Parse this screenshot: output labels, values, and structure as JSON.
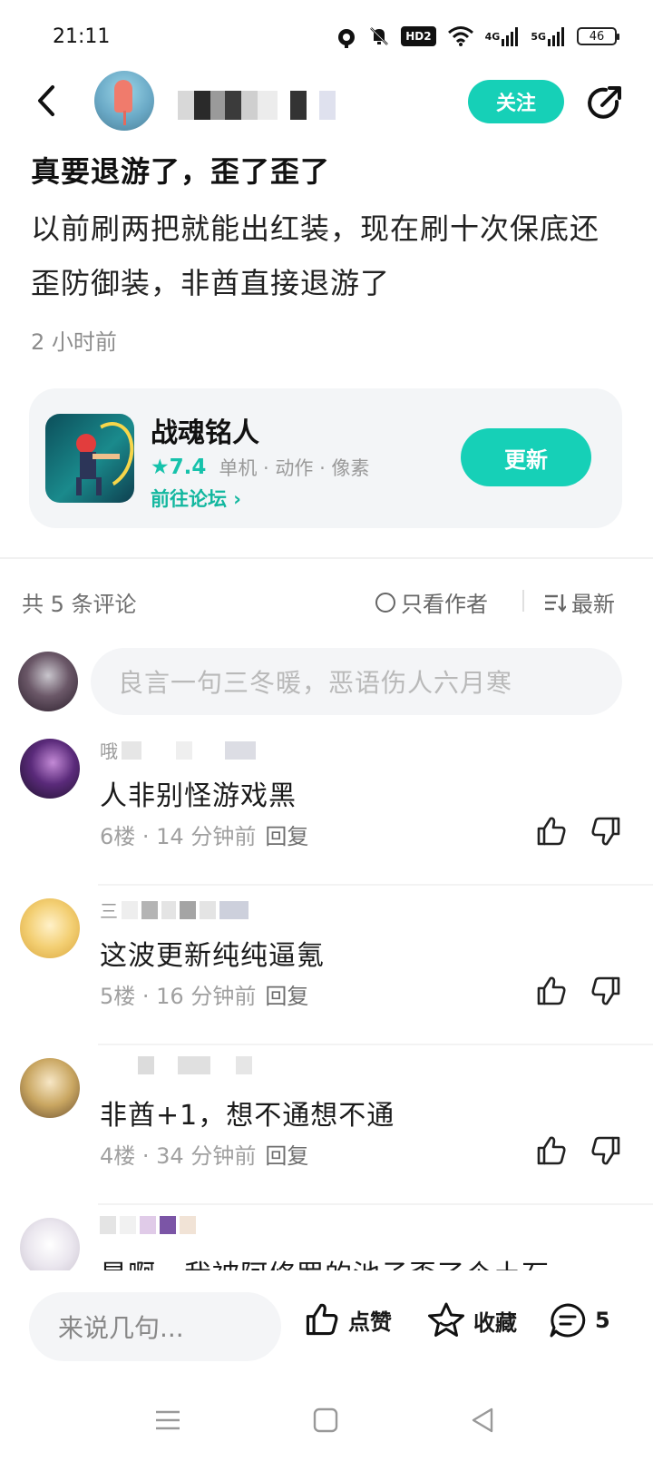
{
  "status_bar": {
    "time": "21:11",
    "icons": [
      "alarm-icon",
      "mute-icon",
      "hd-icon",
      "wifi-icon",
      "signal-4g-icon",
      "signal-5g-icon",
      "battery-icon"
    ],
    "hd_label": "HD2",
    "net_4g": "4G",
    "net_5g": "5G",
    "battery": "46"
  },
  "header": {
    "follow_label": "关注"
  },
  "post": {
    "title": "真要退游了，歪了歪了",
    "body": "以前刷两把就能出红装，现在刷十次保底还歪防御装，非酋直接退游了",
    "time": "2 小时前"
  },
  "game_card": {
    "name": "战魂铭人",
    "rating": "★7.4",
    "tags": "单机 · 动作 · 像素",
    "forum_link": "前往论坛 ›",
    "update_label": "更新"
  },
  "comments_header": {
    "count": "共 5 条评论",
    "author_only": "只看作者",
    "sort": "最新"
  },
  "comment_input": {
    "placeholder": "良言一句三冬暖，恶语伤人六月寒"
  },
  "comments": [
    {
      "name_prefix": "哦",
      "text": "人非别怪游戏黑",
      "meta": "6楼 · 14 分钟前",
      "reply": "回复"
    },
    {
      "name_prefix": "三",
      "text": "这波更新纯纯逼氪",
      "meta": "5楼 · 16 分钟前",
      "reply": "回复"
    },
    {
      "name_prefix": "",
      "text": "非酋+1，想不通想不通",
      "meta": "4楼 · 34 分钟前",
      "reply": "回复"
    },
    {
      "name_prefix": "",
      "text": "是啊，我被阿修罗的池子歪了个土石",
      "meta": "",
      "reply": ""
    }
  ],
  "bottom_bar": {
    "say_placeholder": "来说几句...",
    "like_label": "点赞",
    "collect_label": "收藏",
    "comment_count": "5"
  },
  "colors": {
    "accent": "#16d0b7",
    "accent_text": "#12b79f"
  }
}
